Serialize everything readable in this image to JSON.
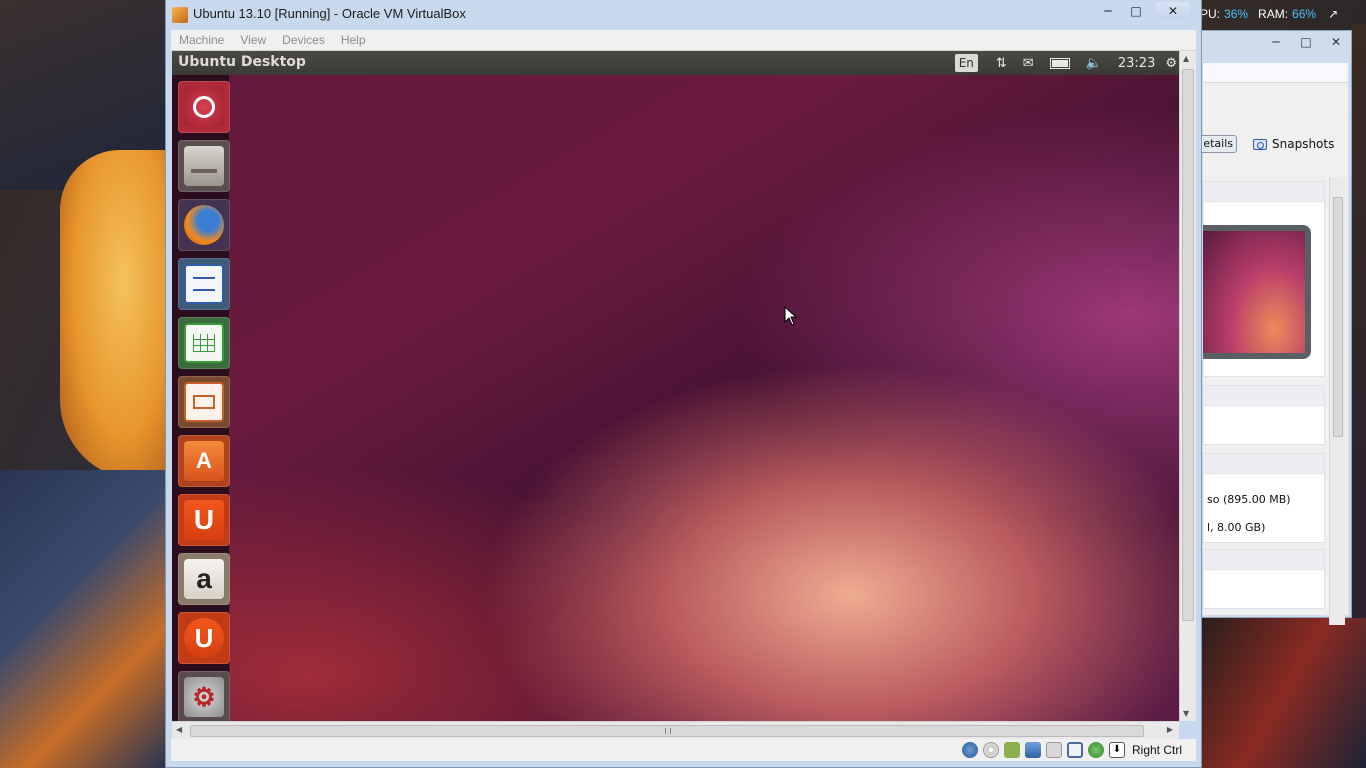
{
  "host": {
    "stats": {
      "cpu_label": "PU:",
      "cpu_value": "36%",
      "ram_label": "RAM:",
      "ram_value": "66%"
    }
  },
  "manager_window": {
    "tabs": {
      "details": "etails",
      "snapshots": "Snapshots"
    },
    "storage_lines": [
      "so (895.00 MB)",
      "l, 8.00 GB)"
    ]
  },
  "vm_window": {
    "title": "Ubuntu 13.10 [Running] - Oracle VM VirtualBox",
    "menu": [
      "Machine",
      "View",
      "Devices",
      "Help"
    ],
    "guest": {
      "panel_title": "Ubuntu Desktop",
      "keyboard_layout": "En",
      "clock": "23:23",
      "launcher": [
        {
          "name": "dash-home",
          "icon": "ubuntu-logo"
        },
        {
          "name": "files",
          "icon": "file-cabinet"
        },
        {
          "name": "firefox",
          "icon": "firefox"
        },
        {
          "name": "libreoffice-writer",
          "icon": "writer-document"
        },
        {
          "name": "libreoffice-calc",
          "icon": "calc-spreadsheet"
        },
        {
          "name": "libreoffice-impress",
          "icon": "impress-presentation"
        },
        {
          "name": "ubuntu-software-center",
          "icon": "shopping-bag"
        },
        {
          "name": "ubuntu-one",
          "icon": "ubuntu-one-u"
        },
        {
          "name": "amazon",
          "icon": "amazon-a"
        },
        {
          "name": "ubuntu-one-music",
          "icon": "headphones-u"
        },
        {
          "name": "system-settings",
          "icon": "wrench-gear"
        }
      ]
    },
    "status_bar": {
      "host_key": "Right Ctrl"
    }
  },
  "colors": {
    "launcher_bg": "#2d0e1e",
    "panel_bg": "#3f3e3a",
    "stats_accent": "#45c2ff"
  }
}
